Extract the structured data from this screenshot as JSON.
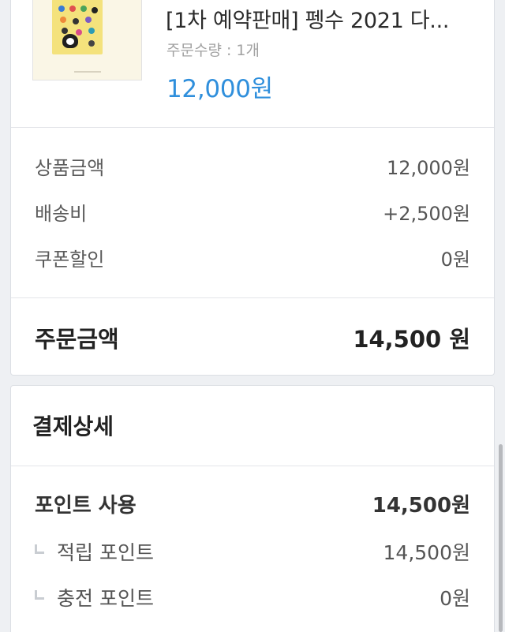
{
  "product": {
    "name": "[1차 예약판매] 펭수 2021 다...",
    "quantity": "주문수량 : 1개",
    "price": "12,000원"
  },
  "summary": {
    "rows": [
      {
        "label": "상품금액",
        "value": "12,000원"
      },
      {
        "label": "배송비",
        "value": "+2,500원"
      },
      {
        "label": "쿠폰할인",
        "value": "0원"
      }
    ],
    "total_label": "주문금액",
    "total_value": "14,500 원"
  },
  "payment": {
    "title": "결제상세",
    "point_label": "포인트 사용",
    "point_value": "14,500원",
    "sub_rows": [
      {
        "label": "적립 포인트",
        "value": "14,500원"
      },
      {
        "label": "충전 포인트",
        "value": "0원"
      }
    ]
  },
  "colors": {
    "accent": "#2f8fdc",
    "background": "#eef0f3"
  }
}
